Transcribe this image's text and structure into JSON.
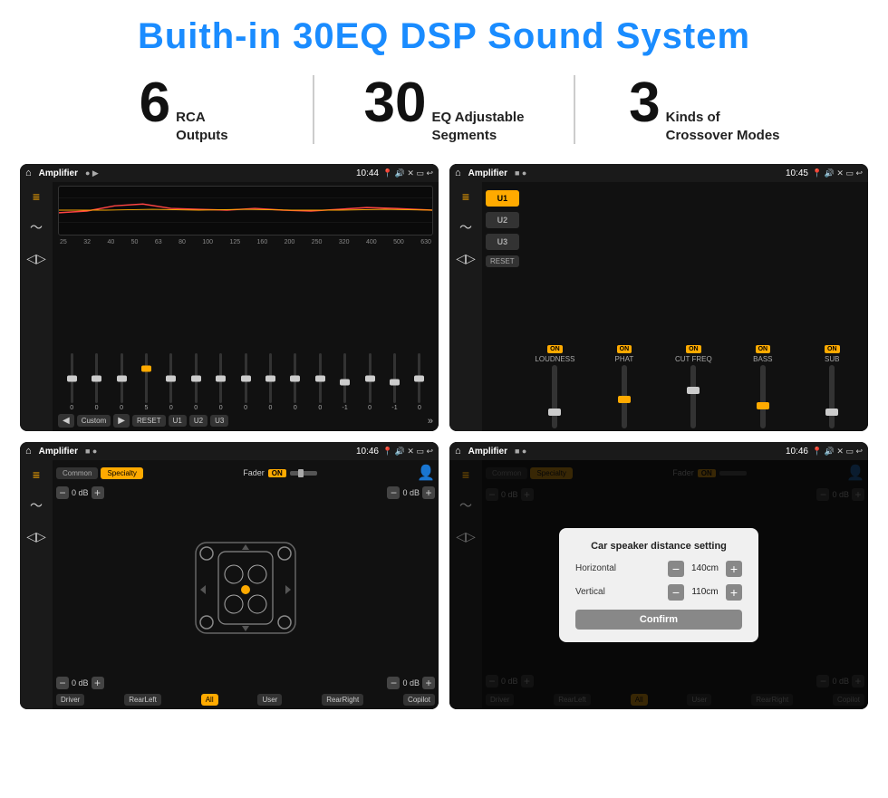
{
  "page": {
    "title": "Buith-in 30EQ DSP Sound System",
    "features": [
      {
        "number": "6",
        "text": "RCA\nOutputs"
      },
      {
        "number": "30",
        "text": "EQ Adjustable\nSegments"
      },
      {
        "number": "3",
        "text": "Kinds of\nCrossover Modes"
      }
    ]
  },
  "screen1": {
    "appName": "Amplifier",
    "time": "10:44",
    "freqs": [
      "25",
      "32",
      "40",
      "50",
      "63",
      "80",
      "100",
      "125",
      "160",
      "200",
      "250",
      "320",
      "400",
      "500",
      "630"
    ],
    "values": [
      "0",
      "0",
      "0",
      "5",
      "0",
      "0",
      "0",
      "0",
      "0",
      "0",
      "0",
      "-1",
      "0",
      "-1"
    ],
    "buttons": [
      "Custom",
      "RESET",
      "U1",
      "U2",
      "U3"
    ]
  },
  "screen2": {
    "appName": "Amplifier",
    "time": "10:45",
    "channels": [
      "LOUDNESS",
      "PHAT",
      "CUT FREQ",
      "BASS",
      "SUB"
    ],
    "uButtons": [
      "U1",
      "U2",
      "U3"
    ],
    "resetLabel": "RESET"
  },
  "screen3": {
    "appName": "Amplifier",
    "time": "10:46",
    "tabs": [
      "Common",
      "Specialty"
    ],
    "faderLabel": "Fader",
    "faderOn": "ON",
    "controls": [
      {
        "label": "0 dB"
      },
      {
        "label": "0 dB"
      },
      {
        "label": "0 dB"
      },
      {
        "label": "0 dB"
      }
    ],
    "bottomBtns": [
      "Driver",
      "RearLeft",
      "All",
      "User",
      "RearRight",
      "Copilot"
    ]
  },
  "screen4": {
    "appName": "Amplifier",
    "time": "10:46",
    "tabs": [
      "Common",
      "Specialty"
    ],
    "dialog": {
      "title": "Car speaker distance setting",
      "horizontal": {
        "label": "Horizontal",
        "value": "140cm"
      },
      "vertical": {
        "label": "Vertical",
        "value": "110cm"
      },
      "confirm": "Confirm"
    },
    "bottomBtns": [
      "Driver",
      "RearLeft",
      "All",
      "User",
      "RearRight",
      "Copilot"
    ]
  }
}
